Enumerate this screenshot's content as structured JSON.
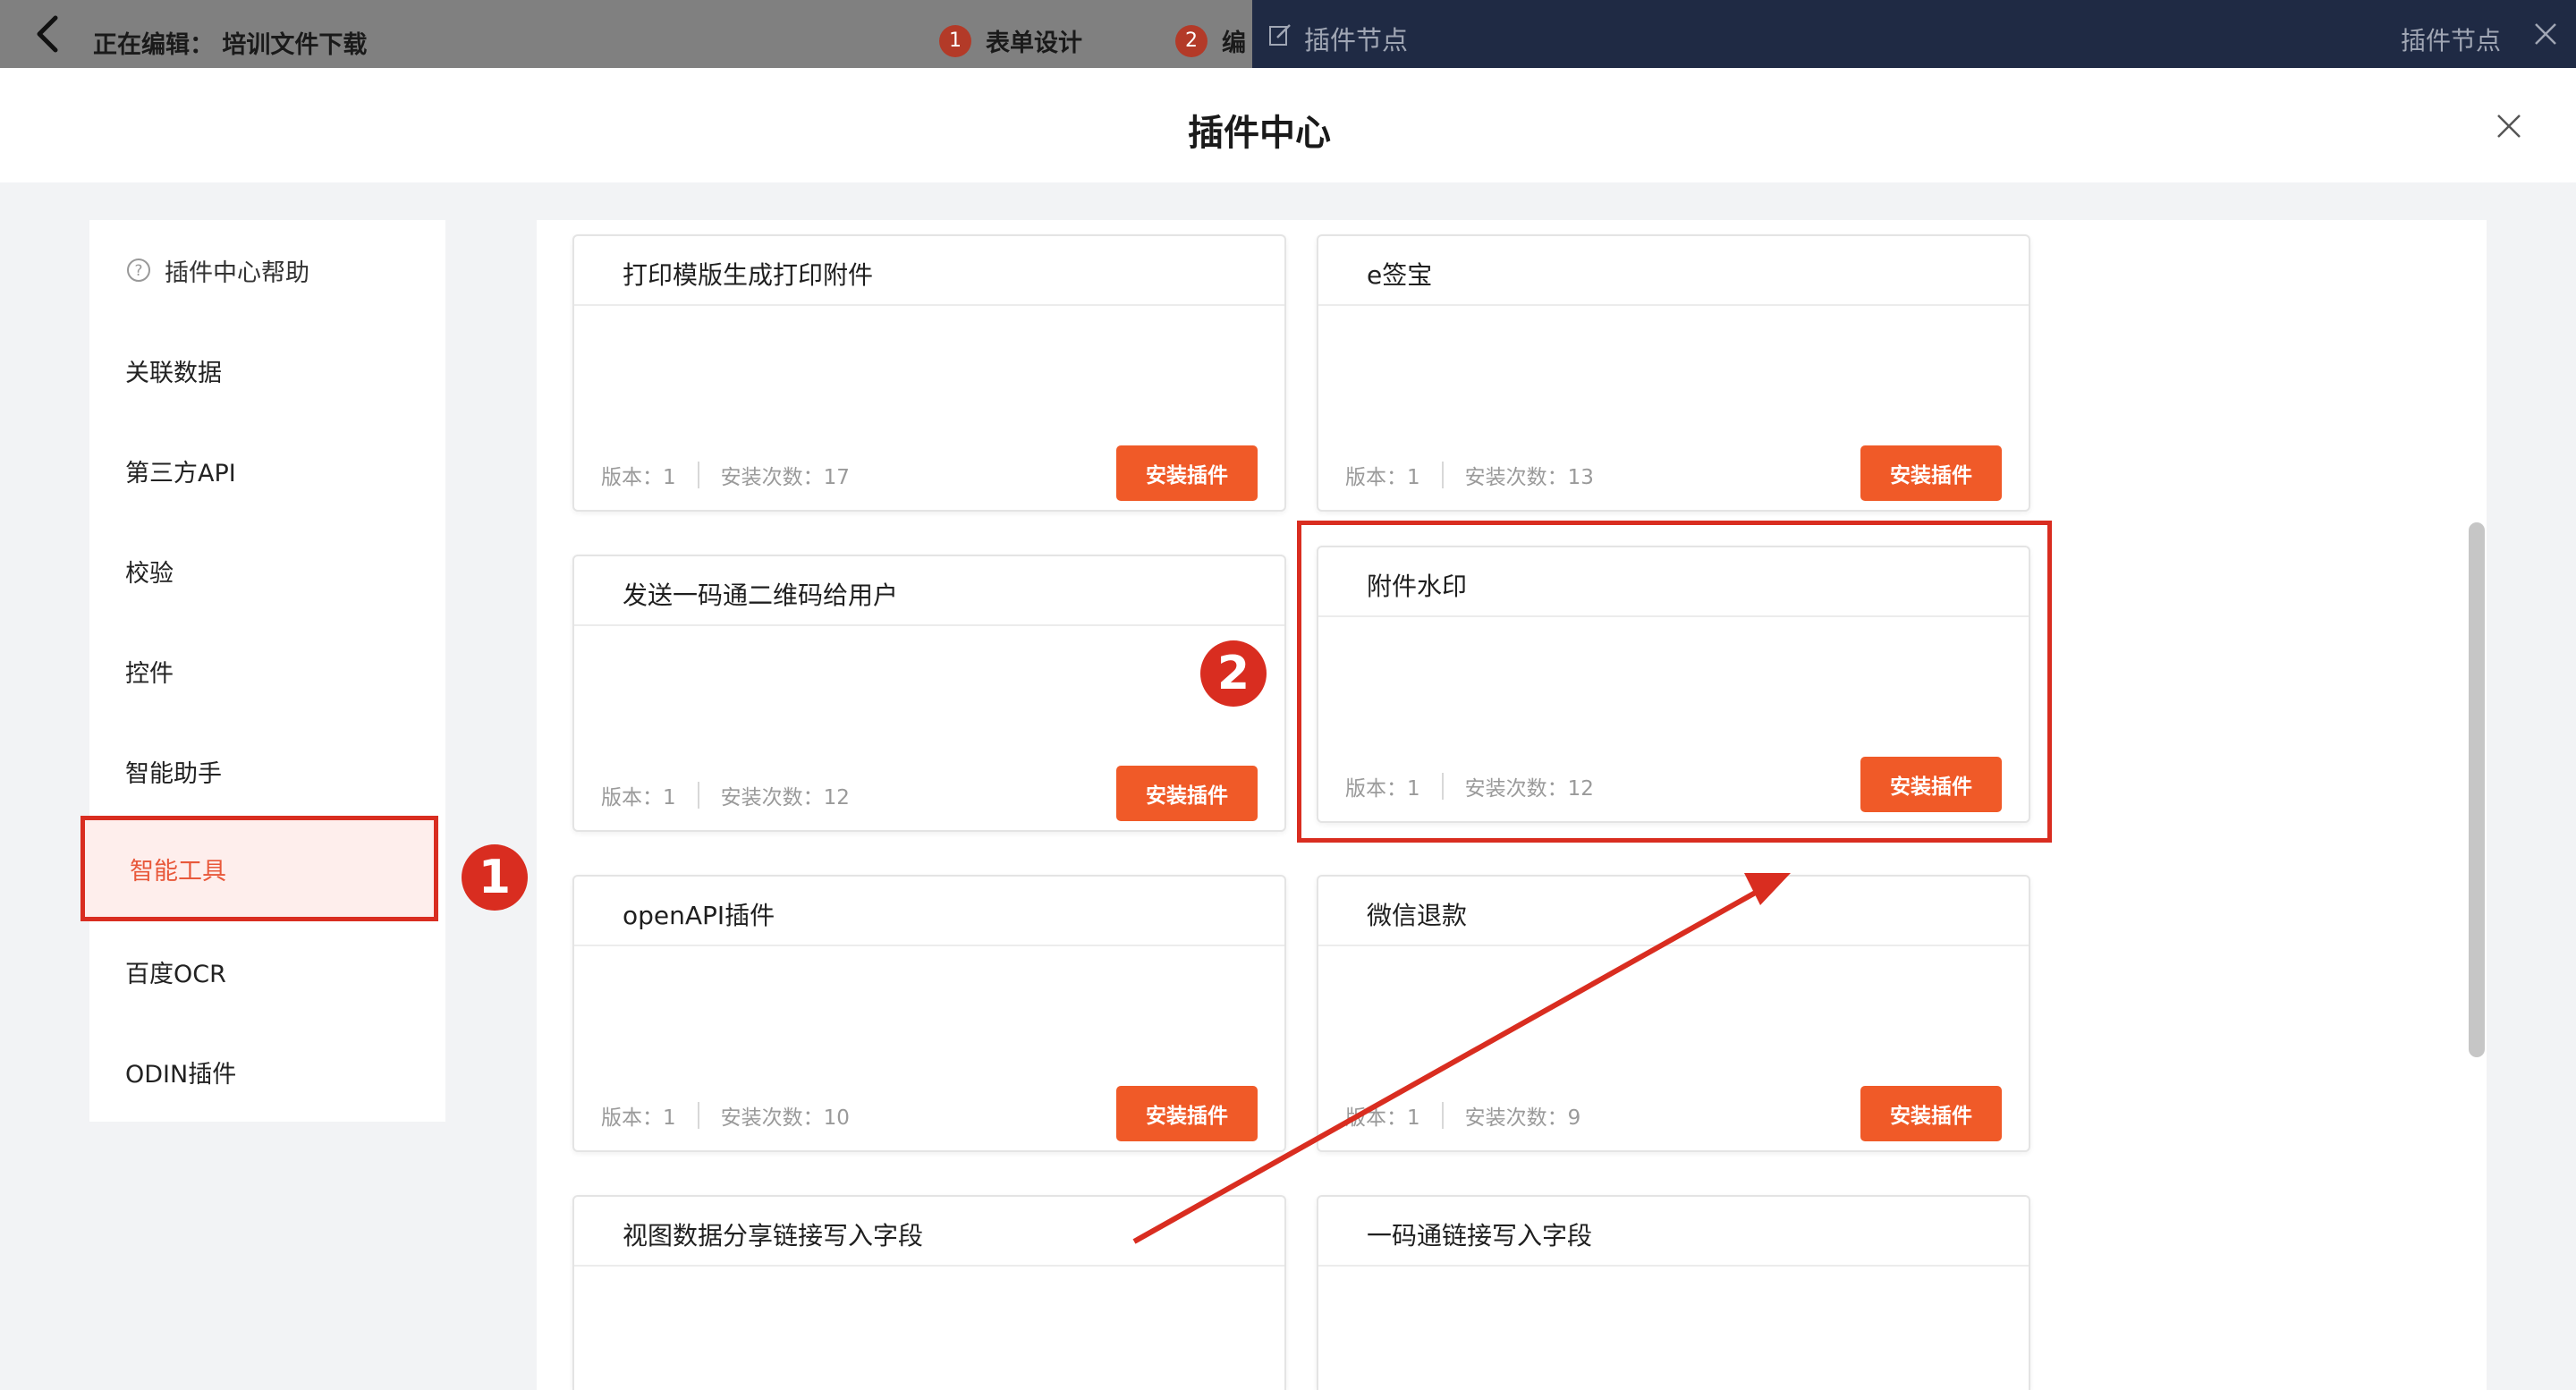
{
  "topbar": {
    "editing_label": "正在编辑：  培训文件下载",
    "steps": [
      {
        "num": "1",
        "label": "表单设计"
      },
      {
        "num": "2",
        "label": "编"
      }
    ],
    "panel_title": "插件节点",
    "panel_right": "插件节点"
  },
  "modal": {
    "title": "插件中心"
  },
  "sidebar": {
    "items": [
      {
        "label": "插件中心帮助"
      },
      {
        "label": "关联数据"
      },
      {
        "label": "第三方API"
      },
      {
        "label": "校验"
      },
      {
        "label": "控件"
      },
      {
        "label": "智能助手"
      },
      {
        "label": "智能工具"
      },
      {
        "label": "百度OCR"
      },
      {
        "label": "ODIN插件"
      }
    ],
    "active_index": 6
  },
  "cards": [
    {
      "title": "打印模版生成打印附件",
      "version": "版本：1",
      "installs": "安装次数：17",
      "button": "安装插件"
    },
    {
      "title": "e签宝",
      "version": "版本：1",
      "installs": "安装次数：13",
      "button": "安装插件"
    },
    {
      "title": "发送一码通二维码给用户",
      "version": "版本：1",
      "installs": "安装次数：12",
      "button": "安装插件"
    },
    {
      "title": "附件水印",
      "version": "版本：1",
      "installs": "安装次数：12",
      "button": "安装插件"
    },
    {
      "title": "openAPI插件",
      "version": "版本：1",
      "installs": "安装次数：10",
      "button": "安装插件"
    },
    {
      "title": "微信退款",
      "version": "版本：1",
      "installs": "安装次数：9",
      "button": "安装插件"
    },
    {
      "title": "视图数据分享链接写入字段"
    },
    {
      "title": "一码通链接写入字段"
    }
  ],
  "annotations": {
    "marker_1": "1",
    "marker_2": "2",
    "color": "#d92d20"
  },
  "colors": {
    "accent": "#f05a28",
    "active_bg": "#feeeec",
    "dark_panel": "#1f2a44"
  }
}
